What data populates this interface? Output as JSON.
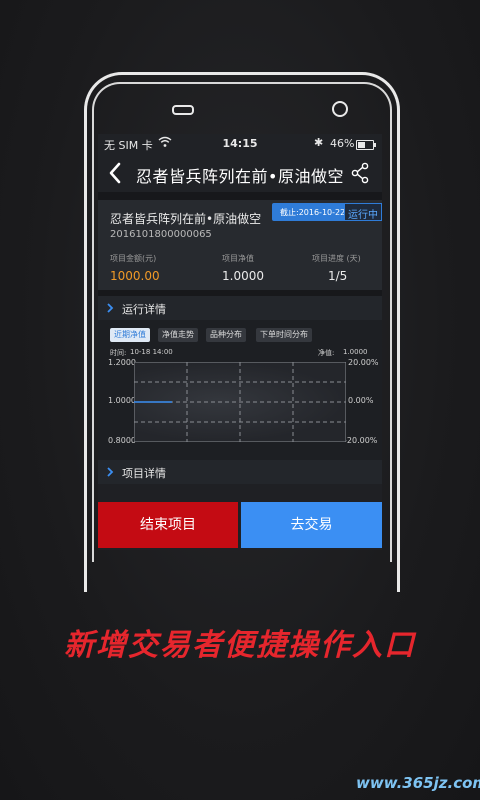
{
  "status_bar": {
    "carrier": "无 SIM 卡",
    "time": "14:15",
    "bluetooth": "✱",
    "battery": "46%"
  },
  "nav": {
    "title": "忍者皆兵阵列在前•原油做空"
  },
  "project": {
    "name": "忍者皆兵阵列在前•原油做空",
    "id": "2016101800000065",
    "deadline": "截止:2016-10-22",
    "status": "运行中",
    "stats": [
      {
        "label": "项目金额(元)",
        "value": "1000.00"
      },
      {
        "label": "项目净值",
        "value": "1.0000"
      },
      {
        "label": "项目进度 (天)",
        "value": "1/5"
      }
    ]
  },
  "sections": {
    "run_details": "运行详情",
    "project_details": "项目详情"
  },
  "chart_tabs": [
    "近期净值",
    "净值走势",
    "品种分布",
    "下单时间分布"
  ],
  "chart_meta": {
    "time_label": "时间:",
    "time_value": "10-18 14:00",
    "nav_label": "净值:",
    "nav_value": "1.0000"
  },
  "chart_data": {
    "type": "line",
    "title": "",
    "series": [
      {
        "values": [
          1.0,
          1.0
        ]
      }
    ],
    "y_ticks": [
      "1.2000",
      "1.0000",
      "0.8000"
    ],
    "y2_ticks": [
      "20.00%",
      "0.00%",
      "-20.00%"
    ],
    "ylim": [
      0.8,
      1.2
    ],
    "grid": true
  },
  "buttons": {
    "end": "结束项目",
    "trade": "去交易"
  },
  "slogan": "新增交易者便捷操作入口",
  "watermark": "www.365jz.com",
  "colors": {
    "accent": "#2f7cd8",
    "end_button": "#c40b13",
    "trade_button": "#3b8ff3",
    "amount": "#f19a27",
    "slogan": "#e6262d"
  }
}
